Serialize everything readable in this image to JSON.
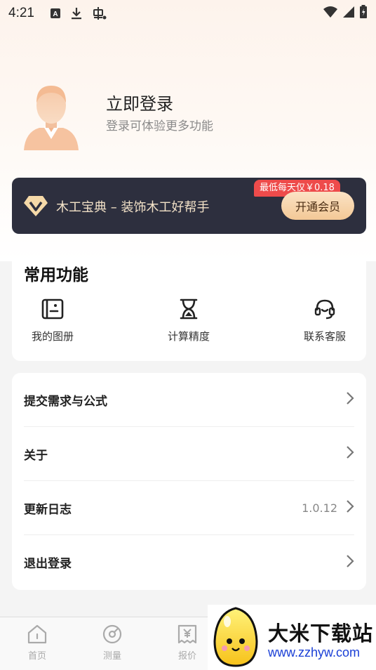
{
  "status_bar": {
    "time": "4:21",
    "icons": [
      "a-badge-icon",
      "download-icon",
      "bug-icon",
      "wifi-icon",
      "signal-icon",
      "battery-icon"
    ]
  },
  "profile": {
    "login_title": "立即登录",
    "login_subtitle": "登录可体验更多功能"
  },
  "vip": {
    "text": "木工宝典 – 装饰木工好帮手",
    "price_badge": "最低每天仅￥0.18",
    "button": "开通会员",
    "colors": {
      "banner": "#2d2f3e",
      "badge": "#ee4b4b",
      "button": "#f3c896"
    }
  },
  "common_functions": {
    "title": "常用功能",
    "items": [
      {
        "label": "我的图册",
        "icon": "album-icon"
      },
      {
        "label": "计算精度",
        "icon": "hourglass-icon"
      },
      {
        "label": "联系客服",
        "icon": "headset-icon"
      }
    ]
  },
  "menu": {
    "items": [
      {
        "label": "提交需求与公式",
        "value": ""
      },
      {
        "label": "关于",
        "value": ""
      },
      {
        "label": "更新日志",
        "value": "1.0.12"
      },
      {
        "label": "退出登录",
        "value": ""
      }
    ]
  },
  "bottom_nav": {
    "items": [
      {
        "label": "首页",
        "icon": "home-icon"
      },
      {
        "label": "测量",
        "icon": "measure-icon"
      },
      {
        "label": "报价",
        "icon": "quote-icon"
      }
    ]
  },
  "watermark": {
    "title": "大米下载站",
    "url": "www.zzhyw.com"
  }
}
